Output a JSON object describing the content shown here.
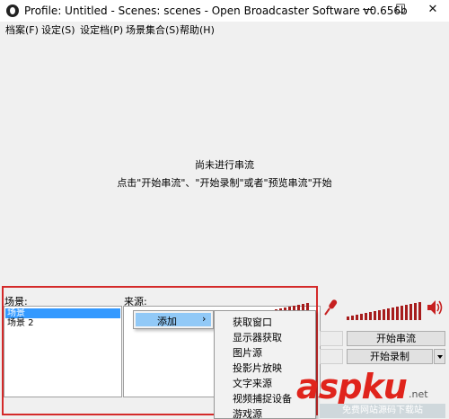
{
  "window": {
    "title": "Profile: Untitled - Scenes: scenes - Open Broadcaster Software v0.656b",
    "minimize": "—",
    "maximize": "☐",
    "close": "✕"
  },
  "menu": [
    {
      "label": "档案(F)"
    },
    {
      "label": "设定(S)"
    },
    {
      "label": "设定档(P)"
    },
    {
      "label": "场景集合(S)"
    },
    {
      "label": "帮助(H)"
    }
  ],
  "preview": {
    "line1": "尚未进行串流",
    "line2": "点击\"开始串流\"、\"开始录制\"或者\"预览串流\"开始"
  },
  "scenes": {
    "label": "场景:",
    "items": [
      "场景",
      "场景 2"
    ]
  },
  "sources": {
    "label": "来源:"
  },
  "context_menu": {
    "add_label": "添加",
    "arrow": "›"
  },
  "add_submenu": [
    "获取窗口",
    "显示器获取",
    "图片源",
    "投影片放映",
    "文字来源",
    "视频捕捉设备",
    "游戏源"
  ],
  "controls": {
    "start_stream": "开始串流",
    "start_recording": "开始录制"
  },
  "icons": {
    "app": "obs-logo-icon",
    "mic": "microphone-icon",
    "speaker": "speaker-icon"
  },
  "colors": {
    "meter": "#a61c1c",
    "highlight_frame": "#d42a2a",
    "selection": "#3399ff",
    "menu_hover": "#91c9f7"
  },
  "watermark": {
    "brand": "aspku",
    "domain": ".net",
    "tagline": "免费网站源码下载站"
  }
}
